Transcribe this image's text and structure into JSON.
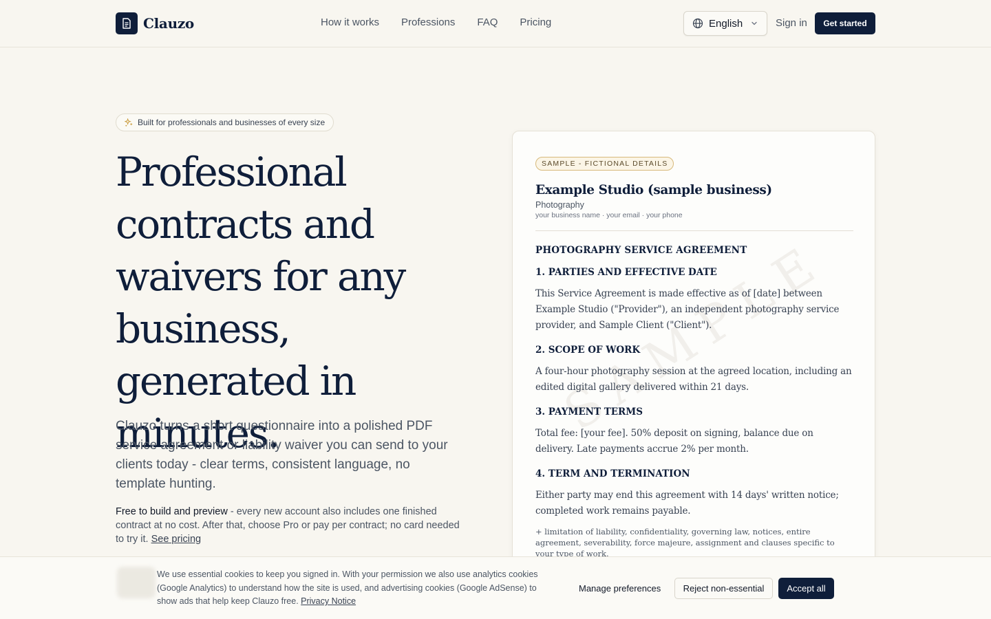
{
  "brand": {
    "name": "Clauzo",
    "logo_icon": "document-icon",
    "primary_color": "#0f1e3a"
  },
  "nav": {
    "items": [
      "How it works",
      "Professions",
      "FAQ",
      "Pricing"
    ]
  },
  "header": {
    "language": "English",
    "sign_in": "Sign in",
    "get_started": "Get started"
  },
  "hero": {
    "badge": "Built for professionals and businesses of every size",
    "badge_icon": "sparkle-icon",
    "title": "Professional contracts and waivers for any business, generated in minutes.",
    "subtitle": "Clauzo turns a short questionnaire into a polished PDF service agreement or liability waiver you can send to your clients today - clear terms, consistent language, no template hunting.",
    "note_strong": "Free to build and preview",
    "note_text": " - every new account also includes one finished contract at no cost. After that, choose Pro or pay per contract; no card needed to try it. ",
    "note_link": "See pricing"
  },
  "sample": {
    "tag": "SAMPLE - FICTIONAL DETAILS",
    "business_name": "Example Studio (sample business)",
    "business_type": "Photography",
    "contact": "your business name · your email · your phone",
    "doc_title": "PHOTOGRAPHY SERVICE AGREEMENT",
    "sections": [
      {
        "heading": "1. PARTIES AND EFFECTIVE DATE",
        "body": "This Service Agreement is made effective as of [date] between Example Studio (\"Provider\"), an independent photography service provider, and Sample Client (\"Client\")."
      },
      {
        "heading": "2. SCOPE OF WORK",
        "body": "A four-hour photography session at the agreed location, including an edited digital gallery delivered within 21 days."
      },
      {
        "heading": "3. PAYMENT TERMS",
        "body": "Total fee: [your fee]. 50% deposit on signing, balance due on delivery. Late payments accrue 2% per month."
      },
      {
        "heading": "4. TERM AND TERMINATION",
        "body": "Either party may end this agreement with 14 days' written notice; completed work remains payable."
      }
    ],
    "more": "+ limitation of liability, confidentiality, governing law, notices, entire agreement, severability, force majeure, assignment and clauses specific to your type of work.",
    "watermark": "SAMPLE"
  },
  "cookie": {
    "text": "We use essential cookies to keep you signed in. With your permission we also use analytics cookies (Google Analytics) to understand how the site is used, and advertising cookies (Google AdSense) to show ads that help keep Clauzo free. ",
    "link": "Privacy Notice",
    "manage": "Manage preferences",
    "reject": "Reject non-essential",
    "accept": "Accept all"
  }
}
